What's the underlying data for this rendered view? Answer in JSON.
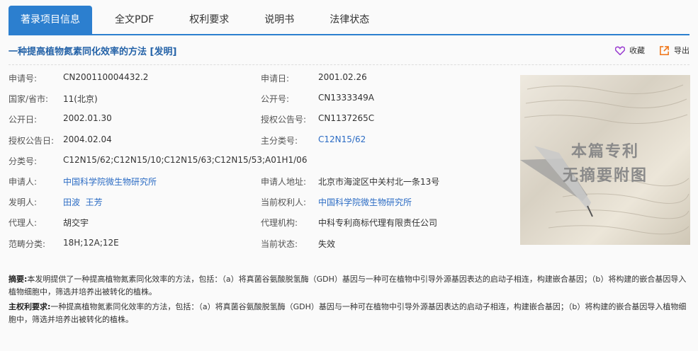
{
  "tabs": [
    {
      "label": "著录项目信息"
    },
    {
      "label": "全文PDF"
    },
    {
      "label": "权利要求"
    },
    {
      "label": "说明书"
    },
    {
      "label": "法律状态"
    }
  ],
  "title": "一种提高植物氮素同化效率的方法 [发明]",
  "actions": {
    "favorite": "收藏",
    "export": "导出"
  },
  "fields": {
    "app_no_label": "申请号:",
    "app_no": "CN200110004432.2",
    "app_date_label": "申请日:",
    "app_date": "2001.02.26",
    "country_label": "国家/省市:",
    "country": "11(北京)",
    "pub_no_label": "公开号:",
    "pub_no": "CN1333349A",
    "pub_date_label": "公开日:",
    "pub_date": "2002.01.30",
    "grant_no_label": "授权公告号:",
    "grant_no": "CN1137265C",
    "grant_date_label": "授权公告日:",
    "grant_date": "2004.02.04",
    "main_class_label": "主分类号:",
    "main_class": "C12N15/62",
    "class_label": "分类号:",
    "class": "C12N15/62;C12N15/10;C12N15/63;C12N15/53;A01H1/06",
    "applicant_label": "申请人:",
    "applicant": "中国科学院微生物研究所",
    "applicant_addr_label": "申请人地址:",
    "applicant_addr": "北京市海淀区中关村北一条13号",
    "inventor_label": "发明人:",
    "inventor1": "田波",
    "inventor2": "王芳",
    "current_owner_label": "当前权利人:",
    "current_owner": "中国科学院微生物研究所",
    "agent_label": "代理人:",
    "agent": "胡交宇",
    "agency_label": "代理机构:",
    "agency": "中科专利商标代理有限责任公司",
    "scope_label": "范畴分类:",
    "scope": "18H;12A;12E",
    "status_label": "当前状态:",
    "status": "失效"
  },
  "no_figure": {
    "line1": "本篇专利",
    "line2": "无摘要附图"
  },
  "abstract": {
    "label": "摘要:",
    "text": "本发明提供了一种提高植物氮素同化效率的方法，包括：（a）将真菌谷氨酸脱氢酶（GDH）基因与一种可在植物中引导外源基因表达的启动子相连，构建嵌合基因；（b）将构建的嵌合基因导入植物细胞中，筛选并培养出被转化的植株。"
  },
  "main_claim": {
    "label": "主权利要求:",
    "text": "一种提高植物氮素同化效率的方法，包括：（a）将真菌谷氨酸脱氢酶（GDH）基因与一种可在植物中引导外源基因表达的启动子相连，构建嵌合基因；（b）将构建的嵌合基因导入植物细胞中，筛选并培养出被转化的植株。"
  },
  "colors": {
    "accent": "#2c7fcf",
    "link": "#2c6cc4",
    "title": "#2563a8",
    "favorite": "#9b3fd1",
    "export": "#f07b22"
  }
}
